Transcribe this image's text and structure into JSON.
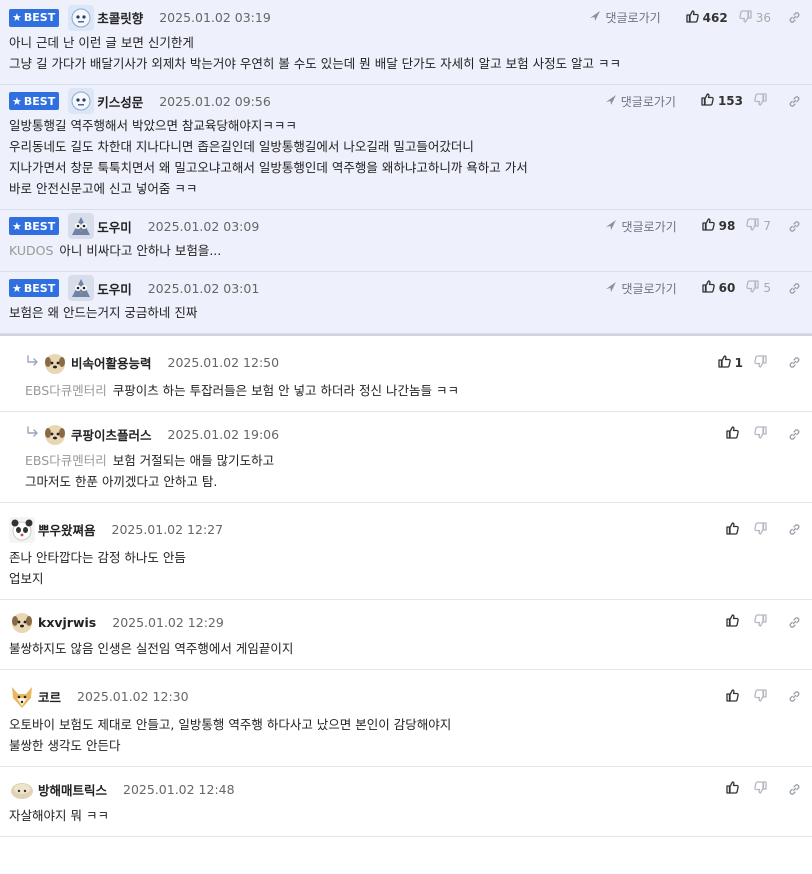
{
  "labels": {
    "best": "BEST",
    "reply_link": "댓글로가기"
  },
  "colors": {
    "best_badge": "#2f6fdf",
    "best_bg": "#eef1fb",
    "meta": "#666666",
    "source": "#999999"
  },
  "comments": [
    {
      "type": "best",
      "avatar": "robot",
      "nick": "초콜릿향",
      "date": "2025.01.02 03:19",
      "up": "462",
      "down": "36",
      "source": "",
      "lines": [
        "아니 근데 난 이런 글 보면 신기한게",
        "그냥 길 가다가 배달기사가 외제차 박는거야 우연히 볼 수도 있는데 뭔 배달 단가도 자세히 알고 보험 사정도 알고 ㅋㅋ"
      ]
    },
    {
      "type": "best",
      "avatar": "robot",
      "nick": "키스성문",
      "date": "2025.01.02 09:56",
      "up": "153",
      "down": "",
      "source": "",
      "lines": [
        "일방통행길 역주행해서 박았으면 참교육당해야지ㅋㅋㅋ",
        "우리동네도 길도 차한대 지나다니면 좁은길인데 일방통행길에서 나오길래 밀고들어갔더니",
        "지나가면서 창문 툭툭치면서 왜 밀고오냐고해서 일방통행인데 역주행을 왜하냐고하니까 욕하고 가서",
        "바로 안전신문고에 신고 넣어줌 ㅋㅋ"
      ]
    },
    {
      "type": "best",
      "avatar": "owl",
      "nick": "도우미",
      "date": "2025.01.02 03:09",
      "up": "98",
      "down": "7",
      "source": "KUDOS",
      "lines": [
        "아니 비싸다고 안하나 보험을..."
      ]
    },
    {
      "type": "best",
      "avatar": "owl",
      "nick": "도우미",
      "date": "2025.01.02 03:01",
      "up": "60",
      "down": "5",
      "source": "",
      "lines": [
        "보험은 왜 안드는거지 궁금하네 진짜"
      ]
    },
    {
      "type": "reply",
      "avatar": "dog",
      "nick": "비속어활용능력",
      "date": "2025.01.02 12:50",
      "up": "1",
      "down": "",
      "source": "EBS다큐멘터리",
      "lines": [
        "쿠팡이츠 하는 투잡러들은 보험 안 넣고 하더라 정신 나간놈들 ㅋㅋ"
      ]
    },
    {
      "type": "reply",
      "avatar": "dog",
      "nick": "쿠팡이츠플러스",
      "date": "2025.01.02 19:06",
      "up": "",
      "down": "",
      "source": "EBS다큐멘터리",
      "lines": [
        "보험 거절되는 애들 많기도하고",
        "그마저도 한푼 아끼겠다고 안하고 탐."
      ]
    },
    {
      "type": "normal",
      "avatar": "panda",
      "nick": "뿌우왔쪄욤",
      "date": "2025.01.02 12:27",
      "up": "",
      "down": "",
      "source": "",
      "lines": [
        "존나 안타깝다는 감정 하나도 안듬",
        "업보지"
      ]
    },
    {
      "type": "normal",
      "avatar": "dog",
      "nick": "kxvjrwis",
      "date": "2025.01.02 12:29",
      "up": "",
      "down": "",
      "source": "",
      "lines": [
        "불쌍하지도 않음 인생은 실전임 역주행에서 게임끝이지"
      ]
    },
    {
      "type": "normal",
      "avatar": "fox",
      "nick": "코르",
      "date": "2025.01.02 12:30",
      "up": "",
      "down": "",
      "source": "",
      "lines": [
        "오토바이 보험도 제대로 안들고, 일방통행 역주행 하다사고 났으면 본인이 감당해야지",
        "불쌍한 생각도 안든다"
      ]
    },
    {
      "type": "normal",
      "avatar": "bun",
      "nick": "방해매트릭스",
      "date": "2025.01.02 12:48",
      "up": "",
      "down": "",
      "source": "",
      "lines": [
        "자살해야지 뭐 ㅋㅋ"
      ]
    }
  ]
}
